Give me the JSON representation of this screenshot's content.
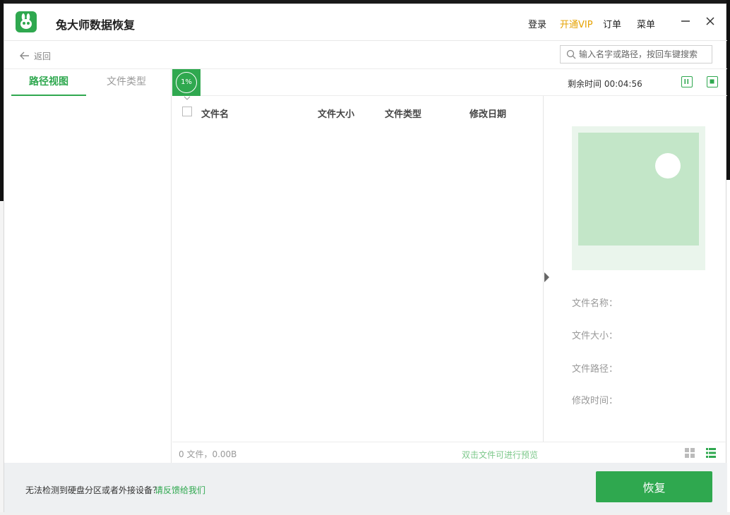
{
  "app": {
    "title": "兔大师数据恢复"
  },
  "top_menu": {
    "login": "登录",
    "vip": "开通VIP",
    "orders": "订单",
    "menu": "菜单"
  },
  "nav": {
    "back_label": "返回",
    "search_placeholder": "输入名字或路径，按回车键搜索"
  },
  "tabs": [
    {
      "label": "路径视图",
      "active": true
    },
    {
      "label": "文件类型",
      "active": false
    }
  ],
  "scan": {
    "progress_percent": 1,
    "progress_label": "1%",
    "remaining": "剩余时间 00:04:56"
  },
  "file_list": {
    "columns": [
      "文件名",
      "文件大小",
      "文件类型",
      "修改日期"
    ],
    "rows": []
  },
  "preview": {
    "labels": [
      "文件名称：",
      "文件大小：",
      "文件路径：",
      "修改时间："
    ]
  },
  "status": {
    "file_count": "0 文件，0.00B",
    "hint": "双击文件可进行预览"
  },
  "footer": {
    "message": "无法检测到硬盘分区或者外接设备？",
    "feedback_link": "请反馈给我们",
    "recover_button": "恢复"
  },
  "colors": {
    "accent": "#2fa84f",
    "vip": "#e6a200"
  }
}
